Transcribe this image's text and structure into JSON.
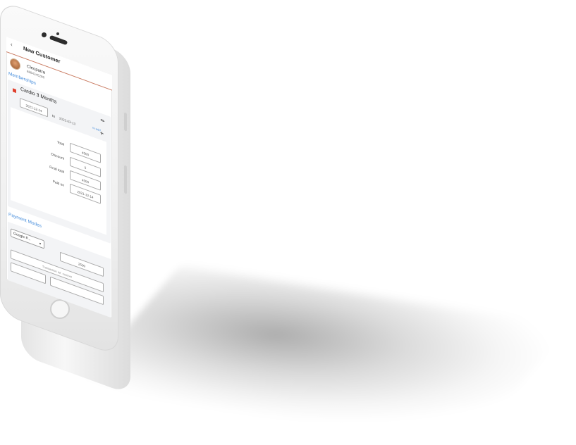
{
  "app": {
    "header_title": "New Customer"
  },
  "customer": {
    "name": "Cleopatra",
    "phone": "8884345288"
  },
  "sections": {
    "memberships": "Memberships",
    "payment_modes": "Payment Modes"
  },
  "membership": {
    "name": "Cardio 3 Months",
    "start_date": "2021-12-14",
    "to_label": "to",
    "end_date": "2022-03-13",
    "readd_label": "re-add",
    "accent_color": "#e0402e"
  },
  "totals": {
    "total_label": "Total",
    "total_value": "4500",
    "discount_label": "Discount",
    "discount_value": "0",
    "final_total_label": "Final total",
    "final_total_value": "4500",
    "paid_on_label": "Paid on",
    "paid_on_value": "2021-12-14"
  },
  "payment": {
    "mode_selected": "Google P...",
    "amount": "2500",
    "reference_placeholder": "Transaction ref. number"
  },
  "colors": {
    "link": "#4a8fdc",
    "header_border": "#c97a60"
  }
}
